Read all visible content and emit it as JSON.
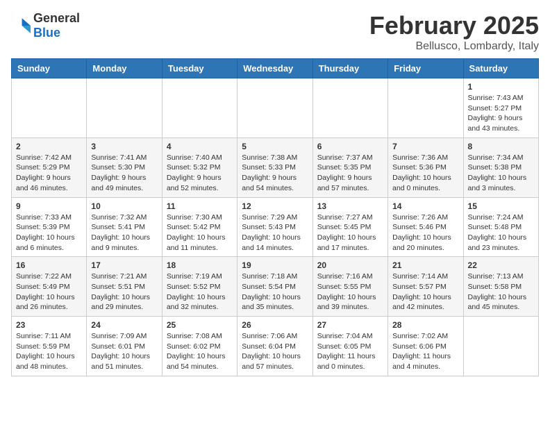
{
  "logo": {
    "general": "General",
    "blue": "Blue"
  },
  "header": {
    "month": "February 2025",
    "location": "Bellusco, Lombardy, Italy"
  },
  "weekdays": [
    "Sunday",
    "Monday",
    "Tuesday",
    "Wednesday",
    "Thursday",
    "Friday",
    "Saturday"
  ],
  "weeks": [
    [
      {
        "day": "",
        "info": ""
      },
      {
        "day": "",
        "info": ""
      },
      {
        "day": "",
        "info": ""
      },
      {
        "day": "",
        "info": ""
      },
      {
        "day": "",
        "info": ""
      },
      {
        "day": "",
        "info": ""
      },
      {
        "day": "1",
        "info": "Sunrise: 7:43 AM\nSunset: 5:27 PM\nDaylight: 9 hours and 43 minutes."
      }
    ],
    [
      {
        "day": "2",
        "info": "Sunrise: 7:42 AM\nSunset: 5:29 PM\nDaylight: 9 hours and 46 minutes."
      },
      {
        "day": "3",
        "info": "Sunrise: 7:41 AM\nSunset: 5:30 PM\nDaylight: 9 hours and 49 minutes."
      },
      {
        "day": "4",
        "info": "Sunrise: 7:40 AM\nSunset: 5:32 PM\nDaylight: 9 hours and 52 minutes."
      },
      {
        "day": "5",
        "info": "Sunrise: 7:38 AM\nSunset: 5:33 PM\nDaylight: 9 hours and 54 minutes."
      },
      {
        "day": "6",
        "info": "Sunrise: 7:37 AM\nSunset: 5:35 PM\nDaylight: 9 hours and 57 minutes."
      },
      {
        "day": "7",
        "info": "Sunrise: 7:36 AM\nSunset: 5:36 PM\nDaylight: 10 hours and 0 minutes."
      },
      {
        "day": "8",
        "info": "Sunrise: 7:34 AM\nSunset: 5:38 PM\nDaylight: 10 hours and 3 minutes."
      }
    ],
    [
      {
        "day": "9",
        "info": "Sunrise: 7:33 AM\nSunset: 5:39 PM\nDaylight: 10 hours and 6 minutes."
      },
      {
        "day": "10",
        "info": "Sunrise: 7:32 AM\nSunset: 5:41 PM\nDaylight: 10 hours and 9 minutes."
      },
      {
        "day": "11",
        "info": "Sunrise: 7:30 AM\nSunset: 5:42 PM\nDaylight: 10 hours and 11 minutes."
      },
      {
        "day": "12",
        "info": "Sunrise: 7:29 AM\nSunset: 5:43 PM\nDaylight: 10 hours and 14 minutes."
      },
      {
        "day": "13",
        "info": "Sunrise: 7:27 AM\nSunset: 5:45 PM\nDaylight: 10 hours and 17 minutes."
      },
      {
        "day": "14",
        "info": "Sunrise: 7:26 AM\nSunset: 5:46 PM\nDaylight: 10 hours and 20 minutes."
      },
      {
        "day": "15",
        "info": "Sunrise: 7:24 AM\nSunset: 5:48 PM\nDaylight: 10 hours and 23 minutes."
      }
    ],
    [
      {
        "day": "16",
        "info": "Sunrise: 7:22 AM\nSunset: 5:49 PM\nDaylight: 10 hours and 26 minutes."
      },
      {
        "day": "17",
        "info": "Sunrise: 7:21 AM\nSunset: 5:51 PM\nDaylight: 10 hours and 29 minutes."
      },
      {
        "day": "18",
        "info": "Sunrise: 7:19 AM\nSunset: 5:52 PM\nDaylight: 10 hours and 32 minutes."
      },
      {
        "day": "19",
        "info": "Sunrise: 7:18 AM\nSunset: 5:54 PM\nDaylight: 10 hours and 35 minutes."
      },
      {
        "day": "20",
        "info": "Sunrise: 7:16 AM\nSunset: 5:55 PM\nDaylight: 10 hours and 39 minutes."
      },
      {
        "day": "21",
        "info": "Sunrise: 7:14 AM\nSunset: 5:57 PM\nDaylight: 10 hours and 42 minutes."
      },
      {
        "day": "22",
        "info": "Sunrise: 7:13 AM\nSunset: 5:58 PM\nDaylight: 10 hours and 45 minutes."
      }
    ],
    [
      {
        "day": "23",
        "info": "Sunrise: 7:11 AM\nSunset: 5:59 PM\nDaylight: 10 hours and 48 minutes."
      },
      {
        "day": "24",
        "info": "Sunrise: 7:09 AM\nSunset: 6:01 PM\nDaylight: 10 hours and 51 minutes."
      },
      {
        "day": "25",
        "info": "Sunrise: 7:08 AM\nSunset: 6:02 PM\nDaylight: 10 hours and 54 minutes."
      },
      {
        "day": "26",
        "info": "Sunrise: 7:06 AM\nSunset: 6:04 PM\nDaylight: 10 hours and 57 minutes."
      },
      {
        "day": "27",
        "info": "Sunrise: 7:04 AM\nSunset: 6:05 PM\nDaylight: 11 hours and 0 minutes."
      },
      {
        "day": "28",
        "info": "Sunrise: 7:02 AM\nSunset: 6:06 PM\nDaylight: 11 hours and 4 minutes."
      },
      {
        "day": "",
        "info": ""
      }
    ]
  ]
}
